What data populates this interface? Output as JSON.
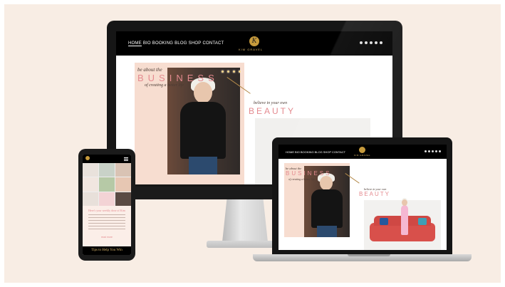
{
  "imac_site": {
    "nav": [
      "HOME",
      "BIO",
      "BOOKING",
      "BLOG",
      "SHOP",
      "CONTACT"
    ],
    "logo_letter": "K",
    "logo_text": "KIM GRAVEL",
    "hero": {
      "about": "be about the",
      "business": "BUSINESS",
      "creating": "of creating a better life",
      "believe": "believe in your own",
      "beauty": "BEAUTY"
    }
  },
  "laptop_site": {
    "nav": [
      "HOME",
      "BIO",
      "BOOKING",
      "BLOG",
      "SHOP",
      "CONTACT"
    ],
    "logo_text": "KIM GRAVEL",
    "hero": {
      "about": "be about the",
      "business": "BUSINESS",
      "creating": "of creating a better life",
      "believe": "believe in your own",
      "beauty": "BEAUTY"
    }
  },
  "phone_site": {
    "heading": "Here's your weekly dose of Kim",
    "link": "read more",
    "footer": "Tips to Help You Win"
  },
  "colors": {
    "background": "#f8ede4",
    "accent_pink": "#e48a8f",
    "gold": "#c69a3c",
    "peach": "#f7ddd0"
  }
}
